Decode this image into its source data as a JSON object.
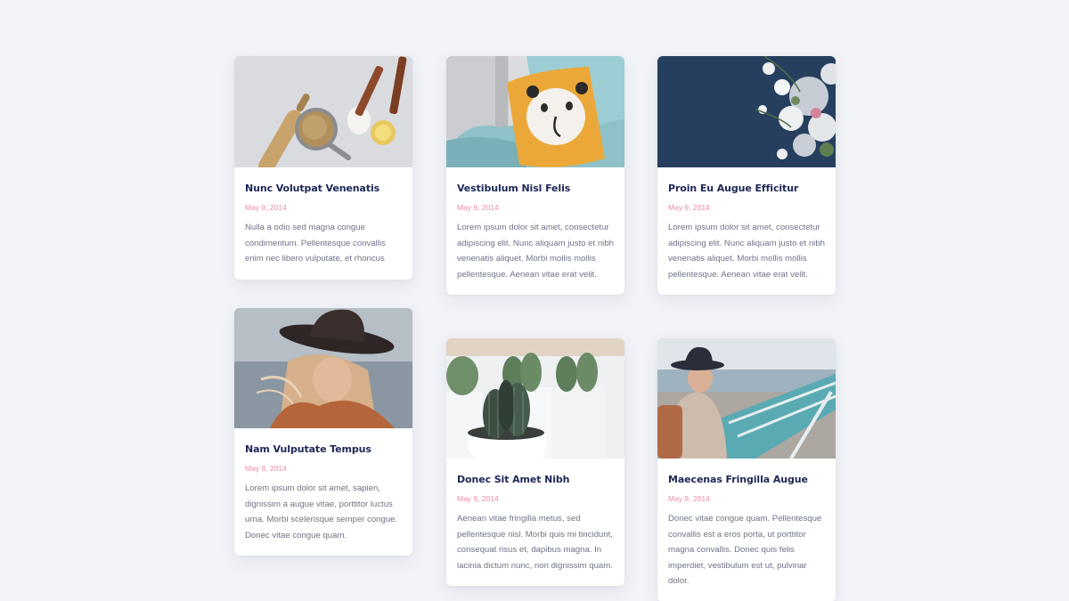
{
  "cards": [
    {
      "title": "Nunc Volutpat Venenatis",
      "date": "May 9, 2014",
      "text": "Nulla a odio sed magna congue condimentum. Pellentesque convallis enim nec libero vulputate, et rhoncus"
    },
    {
      "title": "Vestibulum Nisl Felis",
      "date": "May 9, 2014",
      "text": "Lorem ipsum dolor sit amet, consectetur adipiscing elit. Nunc aliquam justo et nibh venenatis aliquet. Morbi mollis mollis pellentesque. Aenean vitae erat velit."
    },
    {
      "title": "Proin Eu Augue Efficitur",
      "date": "May 9, 2014",
      "text": "Lorem ipsum dolor sit amet, consectetur adipiscing elit. Nunc aliquam justo et nibh venenatis aliquet. Morbi mollis mollis pellentesque. Aenean vitae erat velit."
    },
    {
      "title": "Nam Vulputate Tempus",
      "date": "May 9, 2014",
      "text": "Lorem ipsum dolor sit amet, sapien, dignissim a augue vitae, porttitor luctus urna. Morbi scelerisque semper congue. Donec vitae congue quam."
    },
    {
      "title": "Donec Sit Amet Nibh",
      "date": "May 9, 2014",
      "text": "Aenean vitae fringilla metus, sed pellentesque nisl. Morbi quis mi tincidunt, consequat risus et, dapibus magna. In lacinia dictum nunc, non dignissim quam."
    },
    {
      "title": "Maecenas Fringilla Augue",
      "date": "May 9, 2014",
      "text": "Donec vitae congue quam. Pellentesque convallis est a eros porta, ut porttitor magna convallis. Donec quis felis imperdiet, vestibulum est ut, pulvinar dolor."
    }
  ]
}
